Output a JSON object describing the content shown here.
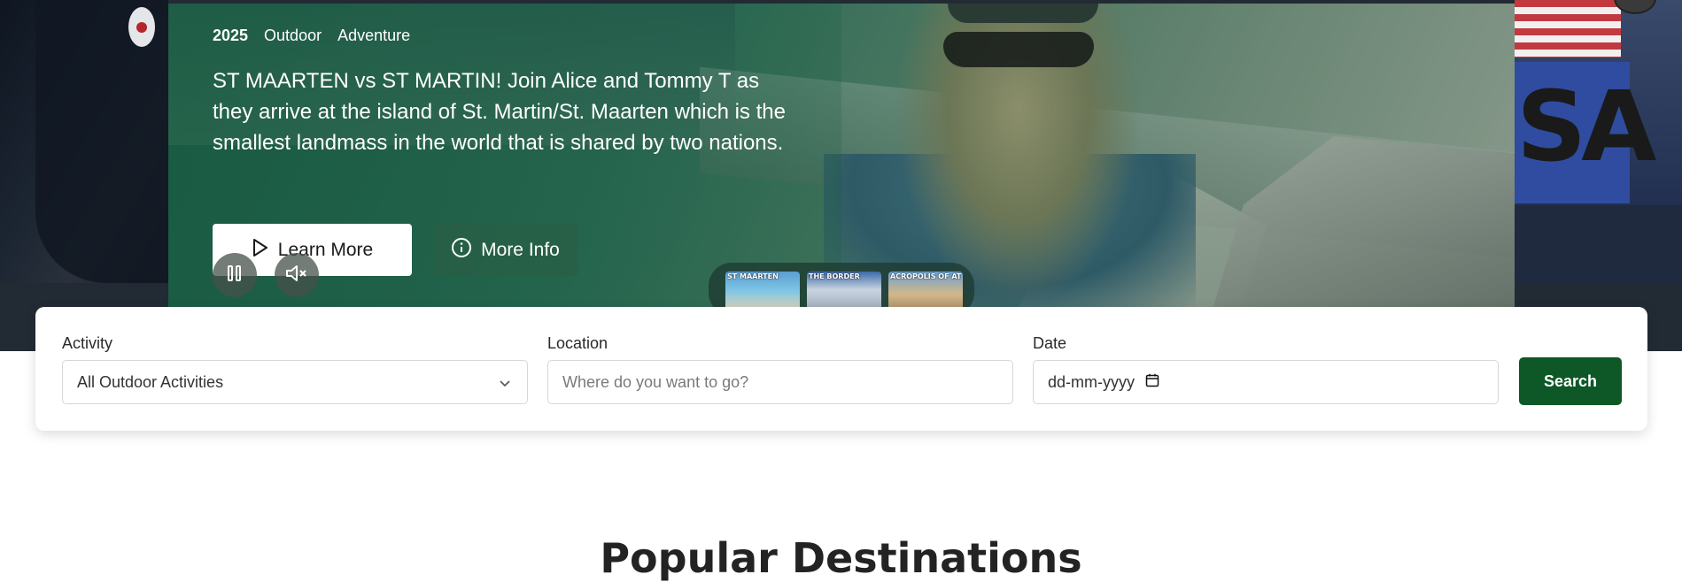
{
  "hero": {
    "tags": [
      "2025",
      "Outdoor",
      "Adventure"
    ],
    "headline": "ST MAARTEN vs ST MARTIN! Join Alice and Tommy T as they arrive at the island of St. Martin/St. Maarten which is the smallest landmass in the world that is shared by two nations.",
    "learn_more_label": "Learn More",
    "more_info_label": "More Info",
    "thumbnails": [
      {
        "label": "ST MAARTEN"
      },
      {
        "label": "THE BORDER"
      },
      {
        "label": "ACROPOLIS OF ATHENS"
      }
    ],
    "side_right_text": "SA",
    "controls": {
      "pause_icon": "pause-icon",
      "mute_icon": "volume-mute-icon"
    }
  },
  "search": {
    "activity_label": "Activity",
    "activity_value": "All Outdoor Activities",
    "location_label": "Location",
    "location_placeholder": "Where do you want to go?",
    "date_label": "Date",
    "date_placeholder": "dd-mm-yyyy",
    "search_button": "Search"
  },
  "popular": {
    "title": "Popular Destinations"
  },
  "colors": {
    "accent_green": "#0d5826",
    "hero_overlay": "#1f5a4a"
  }
}
